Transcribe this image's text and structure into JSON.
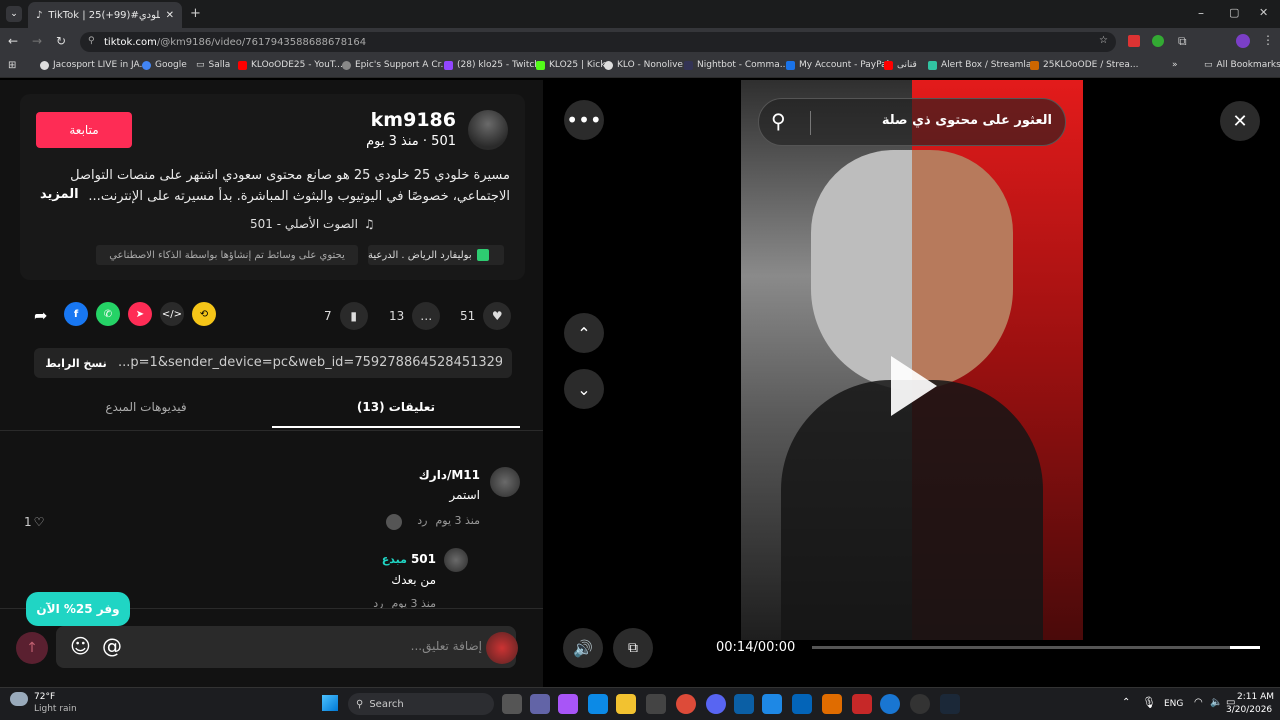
{
  "browser": {
    "tab_title": "TikTok | 25خلودي#(99+)",
    "url_domain": "tiktok.com",
    "url_path": "/@km9186/video/7617943588688678164",
    "bookmarks": [
      "Jacosport LIVE in JA...",
      "Google",
      "Salla",
      "KLOoODE25 - YouT...",
      "Epic's Support A Cr...",
      "(28) klo25 - Twitch",
      "KLO25 | Kick",
      "KLO - Nonolive",
      "Nightbot - Comma...",
      "My Account - PayPal",
      "قنانى",
      "Alert Box / Streamla...",
      "25KLOoODE / Strea..."
    ],
    "all_bookmarks": "All Bookmarks"
  },
  "post": {
    "follow_label": "متابعة",
    "username": "km9186",
    "meta": "501 · منذ 3 يوم",
    "description": "مسيرة خلودي 25 خلودي 25 هو صانع محتوى سعودي اشتهر على منصات التواصل الاجتماعي، خصوصًا في اليوتيوب والبثوث المباشرة. بدأ مسيرته على الإنترنت...",
    "more_label": "المزيد",
    "sound": "الصوت الأصلي - 501",
    "location": "بوليفارد الرياض . الدرعية",
    "ai_note": "يحتوي على وسائط تم إنشاؤها بواسطة الذكاء الاصطناعي",
    "likes": "51",
    "comments": "13",
    "saves": "7",
    "copy_label": "نسخ الرابط",
    "link": "...p=1&sender_device=pc&web_id=7592788645284513292",
    "tab_comments": "(13) تعليقات",
    "tab_creator": "فيديوهات المبدع"
  },
  "comments": [
    {
      "author": "M11/دارك",
      "text": "استمر",
      "time": "منذ 3 يوم",
      "reply": "رد",
      "likes": "1"
    },
    {
      "author": "501",
      "badge": "مبدع",
      "text": "من بعدك",
      "time": "منذ 3 يوم",
      "reply": "رد"
    }
  ],
  "composer": {
    "placeholder": "إضافة تعليق...",
    "at": "@"
  },
  "promo": "وفر 25% الآن",
  "viewer": {
    "search_placeholder": "العثور على محتوى ذي صلة",
    "time": "00:14/00:00"
  },
  "taskbar": {
    "temp": "72°F",
    "weather": "Light rain",
    "search": "Search",
    "lang": "ENG",
    "time": "2:11 AM",
    "date": "3/20/2026"
  },
  "colors": {
    "accent": "#fe2c55",
    "promo": "#20d5c4"
  }
}
